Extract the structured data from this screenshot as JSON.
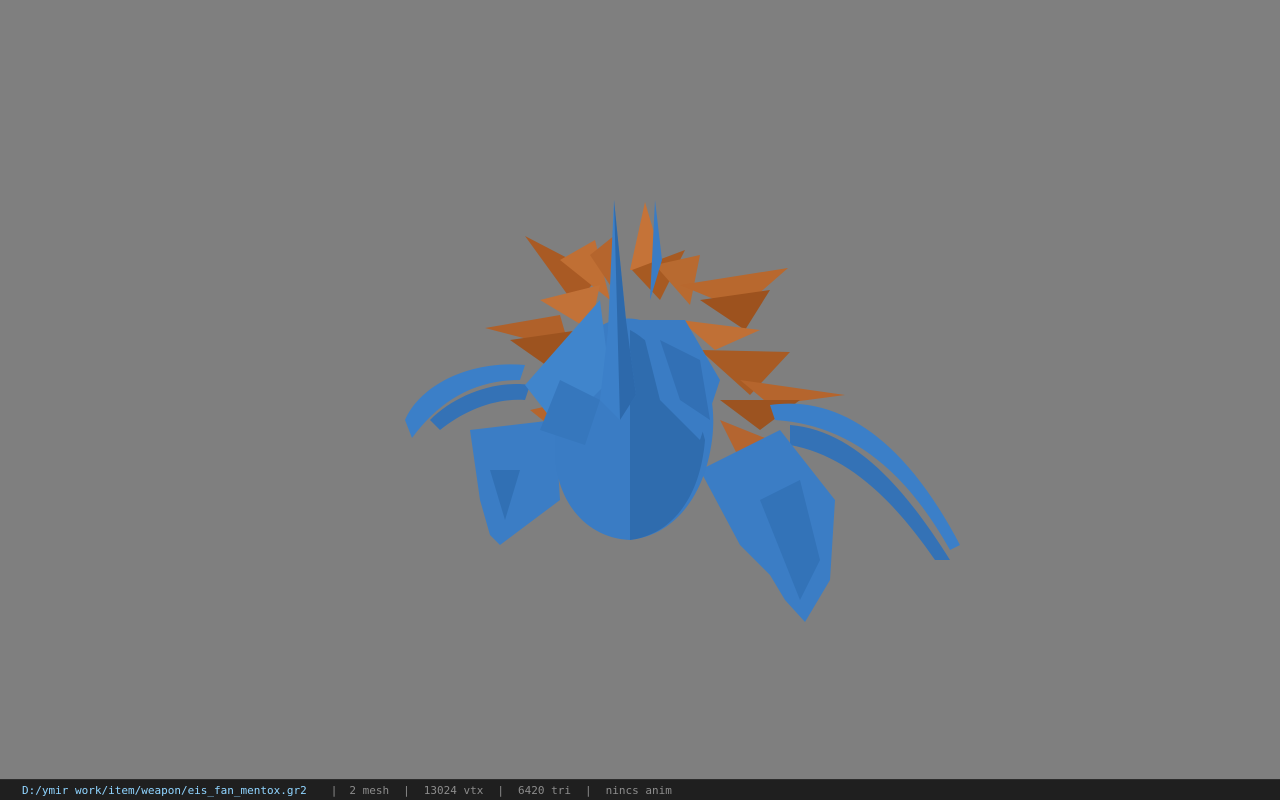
{
  "viewport": {
    "background": "#7f7f7f",
    "model_colors": {
      "blade": "#3a7cc4",
      "feathers": "#b5652d"
    }
  },
  "statusbar": {
    "file_path": "D:/ymir work/item/weapon/eis_fan_mentox.gr2",
    "separator": "|",
    "mesh_count": "2 mesh",
    "vertex_count": "13024 vtx",
    "triangle_count": "6420 tri",
    "anim": "nincs anim"
  }
}
